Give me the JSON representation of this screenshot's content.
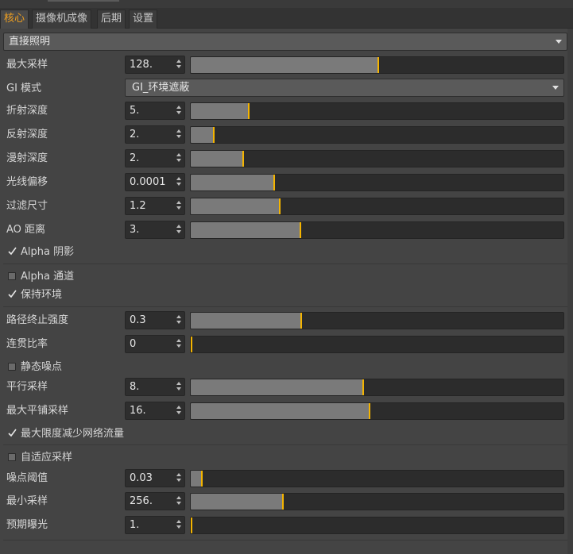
{
  "tabs": [
    "核心",
    "摄像机成像",
    "后期",
    "设置"
  ],
  "section_dropdown": "直接照明",
  "colors": {
    "accent": "#f4b400",
    "active_tab": "#f0a020"
  },
  "rows": [
    {
      "label": "最大采样",
      "value": "128.",
      "fraction": 0.503
    },
    {
      "label": "GI 模式",
      "select": "GI_环境遮蔽"
    },
    {
      "label": "折射深度",
      "value": "5.",
      "fraction": 0.155
    },
    {
      "label": "反射深度",
      "value": "2.",
      "fraction": 0.062
    },
    {
      "label": "漫射深度",
      "value": "2.",
      "fraction": 0.141
    },
    {
      "label": "光线偏移",
      "value": "0.0001",
      "fraction": 0.223
    },
    {
      "label": "过滤尺寸",
      "value": "1.2",
      "fraction": 0.238
    },
    {
      "label": "AO 距离",
      "value": "3.",
      "fraction": 0.294
    }
  ],
  "checks": {
    "alpha_shadow": {
      "label": "Alpha 阴影",
      "checked": true
    },
    "alpha_channel": {
      "label": "Alpha 通道",
      "checked": false
    },
    "keep_env": {
      "label": "保持环境",
      "checked": true
    },
    "static_noise": {
      "label": "静态噪点",
      "checked": false
    },
    "min_net": {
      "label": "最大限度减少网络流量",
      "checked": true
    },
    "adaptive": {
      "label": "自适应采样",
      "checked": false
    }
  },
  "rows2": [
    {
      "label": "路径终止强度",
      "value": "0.3",
      "fraction": 0.296
    },
    {
      "label": "连贯比率",
      "value": "0",
      "fraction": 0.0
    }
  ],
  "rows3": [
    {
      "label": "平行采样",
      "value": "8.",
      "fraction": 0.462
    },
    {
      "label": "最大平铺采样",
      "value": "16.",
      "fraction": 0.479
    }
  ],
  "rows4": [
    {
      "label": "噪点阈值",
      "value": "0.03",
      "fraction": 0.03
    },
    {
      "label": "最小采样",
      "value": "256.",
      "fraction": 0.247
    },
    {
      "label": "预期曝光",
      "value": "1.",
      "fraction": 0.0
    }
  ]
}
